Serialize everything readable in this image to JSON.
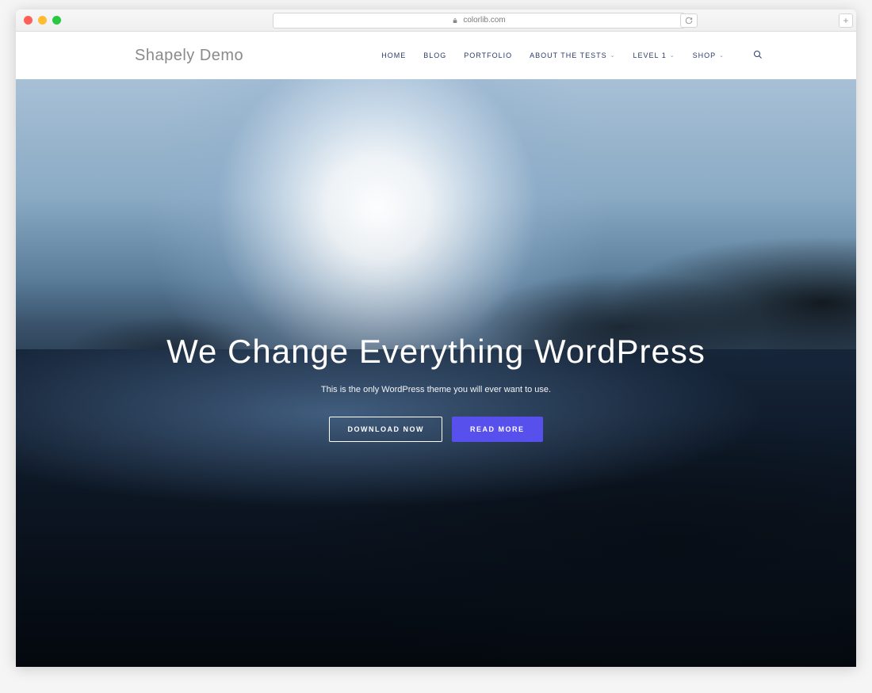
{
  "browser": {
    "url": "colorlib.com"
  },
  "header": {
    "logo": "Shapely Demo",
    "nav": {
      "home": "HOME",
      "blog": "BLOG",
      "portfolio": "PORTFOLIO",
      "about": "ABOUT THE TESTS",
      "level1": "LEVEL 1",
      "shop": "SHOP"
    }
  },
  "hero": {
    "title": "We Change Everything WordPress",
    "subtitle": "This is the only WordPress theme you will ever want to use.",
    "cta_primary": "DOWNLOAD NOW",
    "cta_secondary": "READ MORE"
  },
  "colors": {
    "accent": "#5850ec",
    "nav_text": "#2a3a6a"
  }
}
